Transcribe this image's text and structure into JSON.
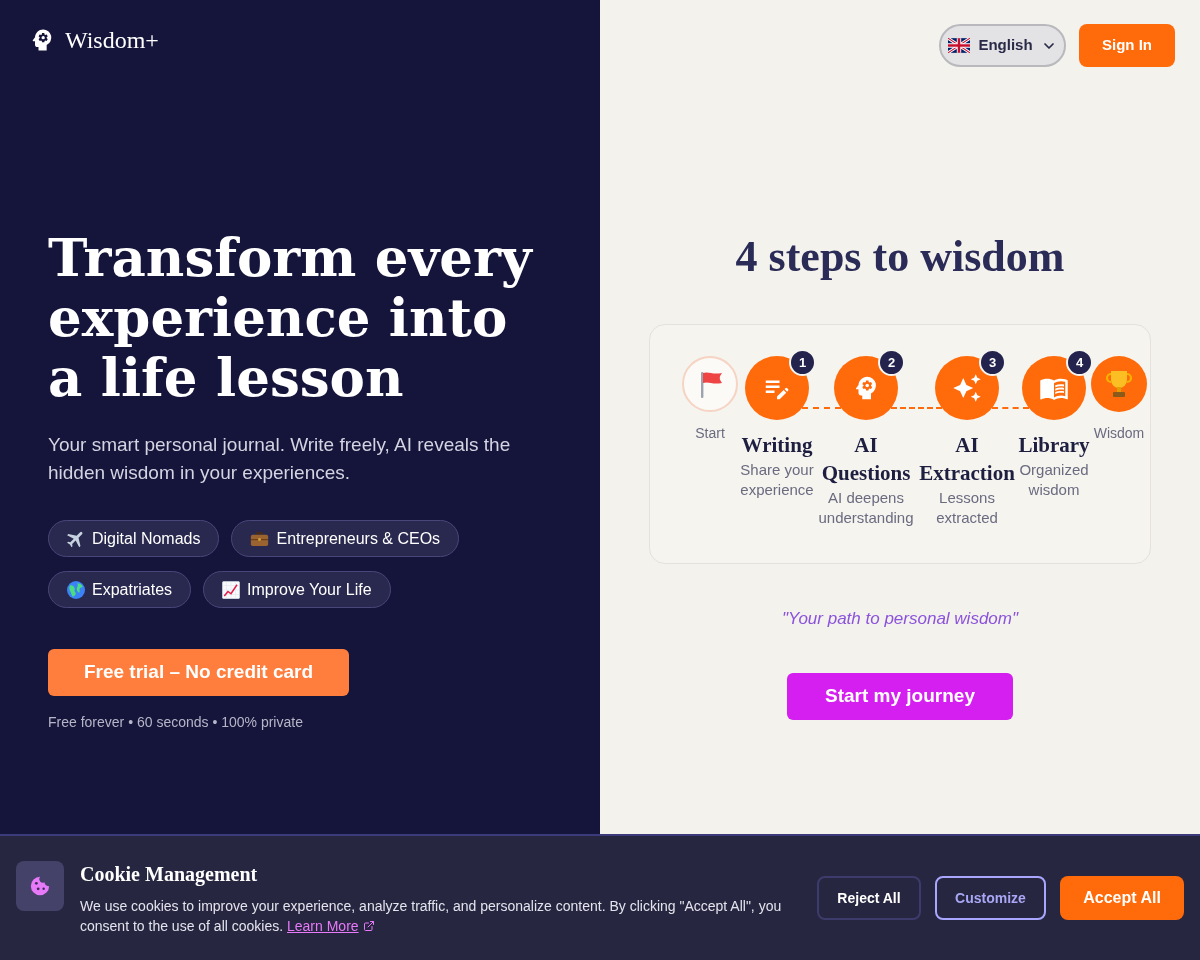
{
  "brand": {
    "name": "Wisdom+"
  },
  "header": {
    "language": "English",
    "sign_in": "Sign In"
  },
  "hero": {
    "headline": "Transform every experience into a life lesson",
    "subtitle": "Your smart personal journal. Write freely, AI reveals the hidden wisdom in your experiences.",
    "tags": [
      {
        "label": "Digital Nomads"
      },
      {
        "label": "Entrepreneurs & CEOs"
      },
      {
        "label": "Expatriates"
      },
      {
        "label": "Improve Your Life"
      }
    ],
    "cta": "Free trial – No credit card",
    "note": "Free forever • 60 seconds • 100% private"
  },
  "steps_panel": {
    "title": "4 steps to wisdom",
    "steps": [
      {
        "kind": "start",
        "label": "Start"
      },
      {
        "kind": "step",
        "number": "1",
        "title": "Writing",
        "description": "Share your experience"
      },
      {
        "kind": "step",
        "number": "2",
        "title": "AI Questions",
        "description": "AI deepens understanding"
      },
      {
        "kind": "step",
        "number": "3",
        "title": "AI Extraction",
        "description": "Lessons extracted"
      },
      {
        "kind": "step",
        "number": "4",
        "title": "Library",
        "description": "Organized wisdom"
      },
      {
        "kind": "finish",
        "label": "Wisdom"
      }
    ],
    "quote": "\"Your path to personal wisdom\"",
    "button": "Start my journey"
  },
  "cookie_banner": {
    "title": "Cookie Management",
    "text": "We use cookies to improve your experience, analyze traffic, and personalize content. By clicking \"Accept All\", you consent to the use of all cookies.",
    "link": "Learn More",
    "buttons": [
      {
        "kind": "reject",
        "label": "Reject All"
      },
      {
        "kind": "customize",
        "label": "Customize"
      },
      {
        "kind": "accept",
        "label": "Accept All"
      }
    ]
  }
}
